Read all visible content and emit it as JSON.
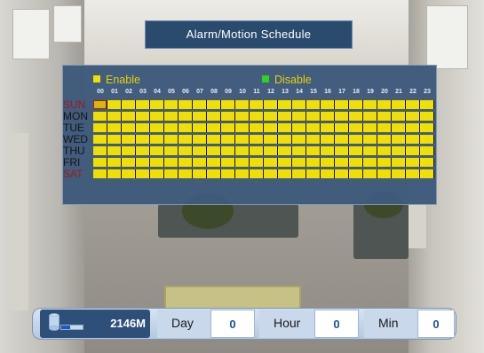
{
  "title": "Alarm/Motion Schedule",
  "legend": {
    "enable_label": "Enable",
    "disable_label": "Disable",
    "enable_color": "#f2e100",
    "disable_color": "#2ad21e"
  },
  "hours": [
    "00",
    "01",
    "02",
    "03",
    "04",
    "05",
    "06",
    "07",
    "08",
    "09",
    "10",
    "11",
    "12",
    "13",
    "14",
    "15",
    "16",
    "17",
    "18",
    "19",
    "20",
    "21",
    "22",
    "23"
  ],
  "days": [
    {
      "label": "SUN",
      "weekend": true,
      "enabled_hours": 24
    },
    {
      "label": "MON",
      "weekend": false,
      "enabled_hours": 24
    },
    {
      "label": "TUE",
      "weekend": false,
      "enabled_hours": 24
    },
    {
      "label": "WED",
      "weekend": false,
      "enabled_hours": 24
    },
    {
      "label": "THU",
      "weekend": false,
      "enabled_hours": 24
    },
    {
      "label": "FRI",
      "weekend": false,
      "enabled_hours": 24
    },
    {
      "label": "SAT",
      "weekend": true,
      "enabled_hours": 24
    }
  ],
  "status": {
    "disk_value": "2146M",
    "disk_icon": "hard-disk-icon",
    "day_label": "Day",
    "day_value": "0",
    "hour_label": "Hour",
    "hour_value": "0",
    "min_label": "Min",
    "min_value": "0"
  }
}
